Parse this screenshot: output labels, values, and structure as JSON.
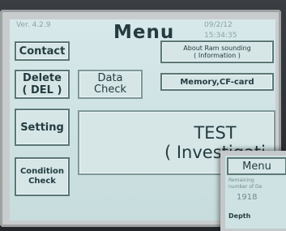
{
  "header": {
    "version": "Ver. 4.2.9",
    "title": "Menu",
    "date": "09/2/12",
    "time": "15:34:35"
  },
  "buttons": {
    "contact": "Contact",
    "about_line1": "About Ram sounding",
    "about_line2": "( Information )",
    "delete_line1": "Delete",
    "delete_line2": "( DEL )",
    "data_check_line1": "Data",
    "data_check_line2": "Check",
    "memory": "Memory,CF-card",
    "setting": "Setting",
    "test_line1": "TEST",
    "test_line2": "( Investigati",
    "condition_line1": "Condition",
    "condition_line2": "Check"
  },
  "inset": {
    "title": "Menu",
    "line1": "Remaining",
    "line2": "number of De",
    "number": "1918",
    "bottom": "Depth"
  }
}
